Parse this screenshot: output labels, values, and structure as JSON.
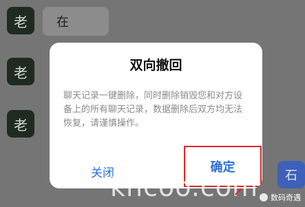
{
  "chat": {
    "avatar_label": "老",
    "bubble_text": "在",
    "right_avatar_label": "石"
  },
  "dialog": {
    "title": "双向撤回",
    "message": "聊天记录一键删除，同时删除销毁您和对方设备上的所有聊天记录，数据删除后双方均无法恢复，请谨慎操作。",
    "cancel_label": "关闭",
    "confirm_label": "确定"
  },
  "overlay": {
    "watermark": "khcoo.com",
    "source": "数码奇遇"
  },
  "colors": {
    "accent": "#2c6fd6",
    "highlight": "#e02424"
  }
}
